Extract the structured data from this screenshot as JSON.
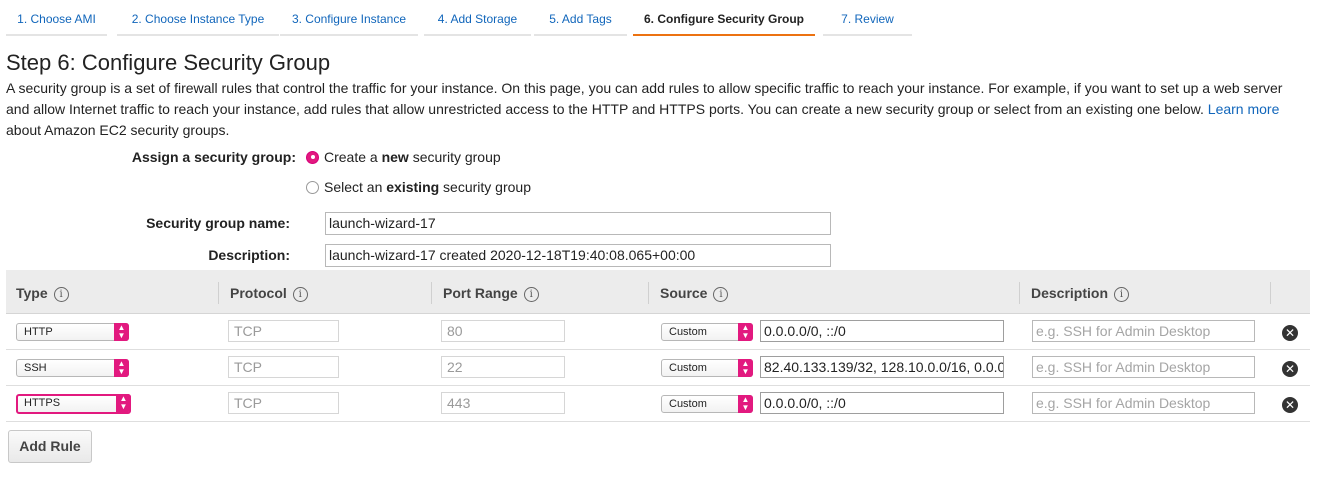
{
  "wizard": {
    "steps": [
      {
        "label": "1. Choose AMI"
      },
      {
        "label": "2. Choose Instance Type"
      },
      {
        "label": "3. Configure Instance"
      },
      {
        "label": "4. Add Storage"
      },
      {
        "label": "5. Add Tags"
      },
      {
        "label": "6. Configure Security Group",
        "active": true
      },
      {
        "label": "7. Review"
      }
    ]
  },
  "page": {
    "title": "Step 6: Configure Security Group",
    "intro": "A security group is a set of firewall rules that control the traffic for your instance. On this page, you can add rules to allow specific traffic to reach your instance. For example, if you want to set up a web server and allow Internet traffic to reach your instance, add rules that allow unrestricted access to the HTTP and HTTPS ports. You can create a new security group or select from an existing one below.",
    "learn_more": "Learn more",
    "intro_tail": "about Amazon EC2 security groups."
  },
  "assign": {
    "label": "Assign a security group:",
    "option_new": {
      "pre": "Create a ",
      "bold": "new",
      "post": " security group",
      "checked": true
    },
    "option_existing": {
      "pre": "Select an ",
      "bold": "existing",
      "post": " security group",
      "checked": false
    }
  },
  "form": {
    "name_label": "Security group name:",
    "name_value": "launch-wizard-17",
    "desc_label": "Description:",
    "desc_value": "launch-wizard-17 created 2020-12-18T19:40:08.065+00:00"
  },
  "table": {
    "headers": {
      "type": "Type",
      "protocol": "Protocol",
      "port_range": "Port Range",
      "source": "Source",
      "description": "Description"
    },
    "info_glyph": "i",
    "rows": [
      {
        "type": "HTTP",
        "protocol": "TCP",
        "port": "80",
        "source_mode": "Custom",
        "source": "0.0.0.0/0, ::/0",
        "description_placeholder": "e.g. SSH for Admin Desktop"
      },
      {
        "type": "SSH",
        "protocol": "TCP",
        "port": "22",
        "source_mode": "Custom",
        "source": "82.40.133.139/32, 128.10.0.0/16, 0.0.0",
        "description_placeholder": "e.g. SSH for Admin Desktop"
      },
      {
        "type": "HTTPS",
        "protocol": "TCP",
        "port": "443",
        "source_mode": "Custom",
        "source": "0.0.0.0/0, ::/0",
        "description_placeholder": "e.g. SSH for Admin Desktop"
      }
    ],
    "remove_glyph": "✕"
  },
  "actions": {
    "add_rule": "Add Rule"
  },
  "colors": {
    "accent_pink": "#e2197f",
    "active_tab_underline": "#ec7211",
    "link": "#1166bb"
  }
}
